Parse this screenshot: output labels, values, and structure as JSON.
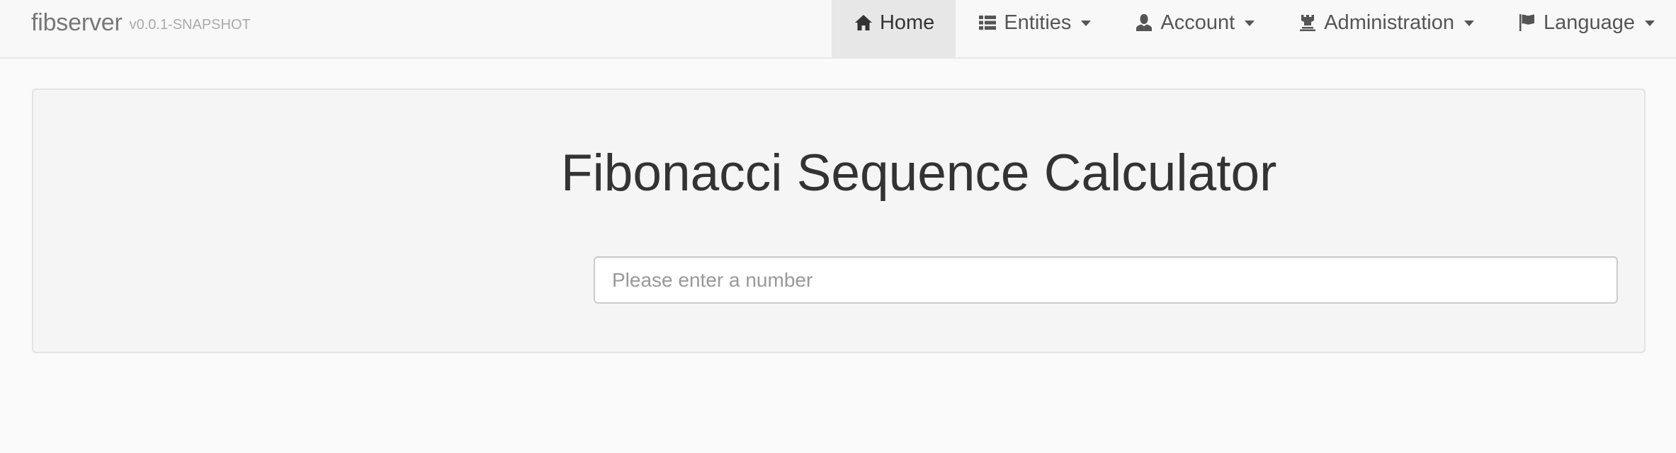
{
  "brand": {
    "name": "fibserver",
    "version": "v0.0.1-SNAPSHOT"
  },
  "nav": {
    "items": [
      {
        "label": "Home",
        "icon": "home-icon",
        "active": true,
        "dropdown": false
      },
      {
        "label": "Entities",
        "icon": "th-list-icon",
        "active": false,
        "dropdown": true
      },
      {
        "label": "Account",
        "icon": "user-icon",
        "active": false,
        "dropdown": true
      },
      {
        "label": "Administration",
        "icon": "tower-icon",
        "active": false,
        "dropdown": true
      },
      {
        "label": "Language",
        "icon": "flag-icon",
        "active": false,
        "dropdown": true
      }
    ]
  },
  "main": {
    "title": "Fibonacci Sequence Calculator",
    "input": {
      "value": "",
      "placeholder": "Please enter a number"
    }
  },
  "colors": {
    "navbar_bg": "#f8f8f8",
    "active_nav_bg": "#e7e7e7",
    "jumbotron_bg": "#f5f5f5",
    "text": "#333333",
    "muted": "#777777"
  }
}
